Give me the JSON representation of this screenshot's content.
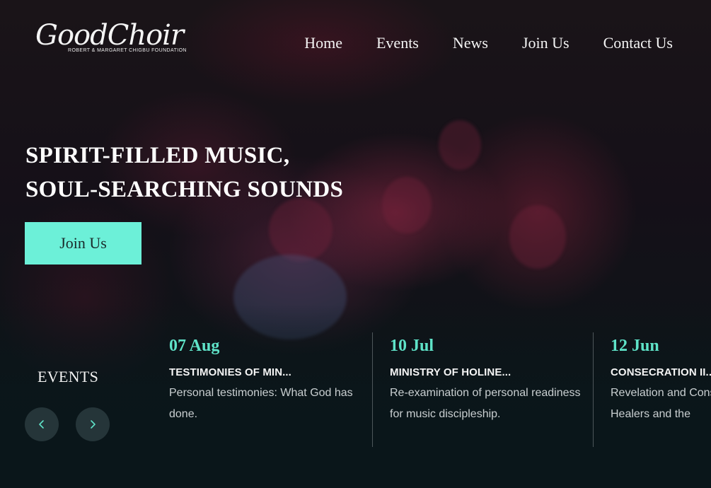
{
  "brand": {
    "logo_text": "GoodChoir",
    "logo_subtitle": "ROBERT & MARGARET CHIGBU FOUNDATION"
  },
  "nav": {
    "items": [
      {
        "label": "Home"
      },
      {
        "label": "Events"
      },
      {
        "label": "News"
      },
      {
        "label": "Join Us"
      },
      {
        "label": "Contact Us"
      }
    ]
  },
  "hero": {
    "title_line1": "SPIRIT-FILLED MUSIC,",
    "title_line2": "SOUL-SEARCHING SOUNDS",
    "cta_label": "Join Us"
  },
  "events": {
    "heading": "EVENTS",
    "prev_icon": "chevron-left-icon",
    "next_icon": "chevron-right-icon",
    "items": [
      {
        "date": "07 Aug",
        "title": "TESTIMONIES OF MIN...",
        "description": "Personal testimonies: What God has done."
      },
      {
        "date": "10 Jul",
        "title": "MINISTRY OF HOLINE...",
        "description": "Re-examination of personal readiness for music discipleship."
      },
      {
        "date": "12 Jun",
        "title": "CONSECRATION II...",
        "description": "Revelation and Consecration of Music Healers and the"
      }
    ]
  },
  "colors": {
    "accent": "#6cf0d8",
    "date_text": "#5fe3c8",
    "background": "#0b1216"
  }
}
